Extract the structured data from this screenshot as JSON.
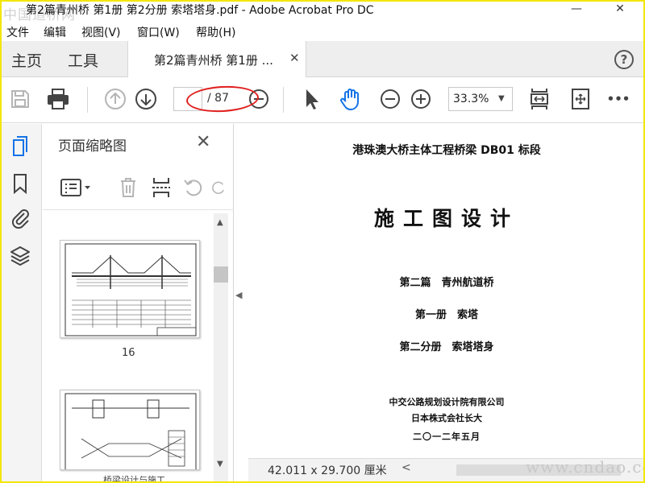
{
  "window": {
    "title": "第2篇青州桥 第1册 第2分册 索塔塔身.pdf - Adobe Acrobat Pro DC",
    "watermark_top": "中国道桥网",
    "minimize_glyph": "—",
    "close_glyph": "✕"
  },
  "menu": {
    "items": [
      "文件",
      "编辑",
      "视图(V)",
      "窗口(W)",
      "帮助(H)"
    ]
  },
  "tabs": {
    "home": "主页",
    "tools": "工具",
    "document": "第2篇青州桥 第1册 ...",
    "close_glyph": "✕",
    "help_glyph": "?"
  },
  "toolbar": {
    "page_total": "/ 87",
    "zoom": "33.3%",
    "more_glyph": "•••"
  },
  "panel": {
    "title": "页面缩略图",
    "close_glyph": "✕",
    "thumbnail_page": "16"
  },
  "document": {
    "header": "港珠澳大桥主体工程桥梁 DB01 标段",
    "main_title": "施工图设计",
    "part": "第二篇　青州航道桥",
    "volume": "第一册　索塔",
    "subvolume": "第二分册　索塔塔身",
    "org1": "中交公路规划设计院有限公司",
    "org2": "日本株式会社长大",
    "date": "二〇一二年五月"
  },
  "status": {
    "dimensions": "42.011 x 29.700 厘米",
    "scroll_left_glyph": "<",
    "watermark_url": "www.cndao.com",
    "bottom_text": "桥梁设计与施工"
  },
  "colors": {
    "highlight_ellipse": "#e02020",
    "frame": "#f3e600",
    "selected_icon": "#1473e6"
  }
}
